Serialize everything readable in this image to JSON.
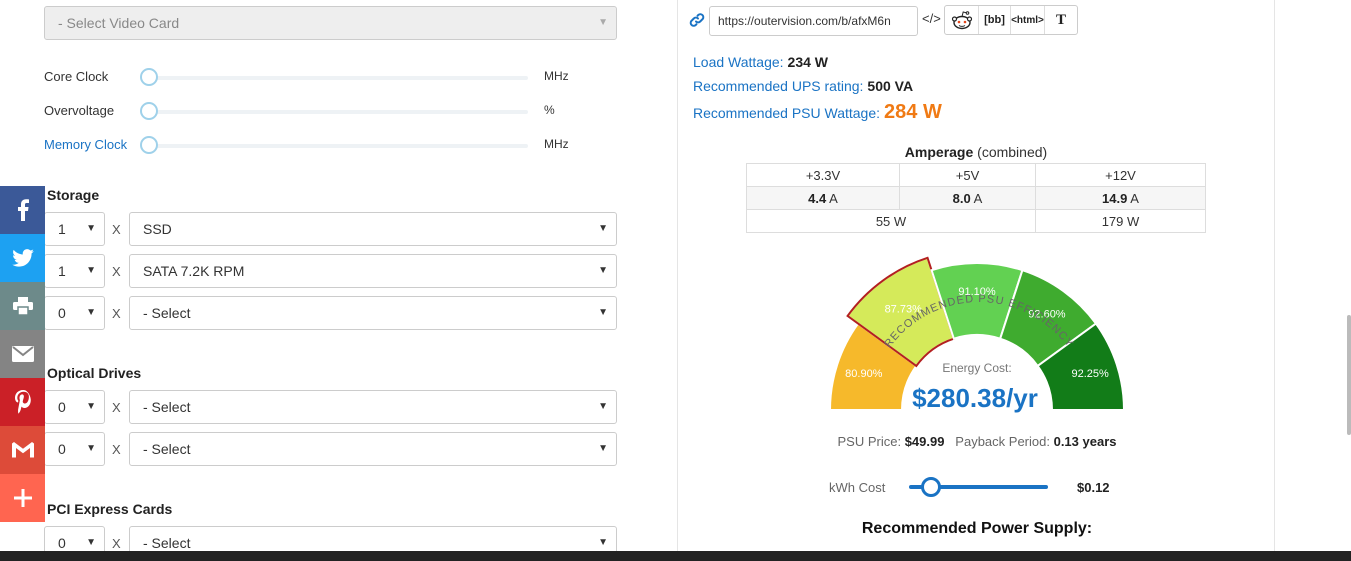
{
  "video_card": {
    "placeholder": "- Select Video Card"
  },
  "sliders": [
    {
      "label": "Core Clock",
      "unit": "MHz"
    },
    {
      "label": "Overvoltage",
      "unit": "%"
    },
    {
      "label": "Memory Clock",
      "unit": "MHz"
    }
  ],
  "x_label": "X",
  "caret": "▼",
  "storage": {
    "title": "Storage",
    "rows": [
      {
        "qty": "1",
        "type": "SSD"
      },
      {
        "qty": "1",
        "type": "SATA 7.2K RPM"
      },
      {
        "qty": "0",
        "type": "- Select"
      }
    ]
  },
  "optical": {
    "title": "Optical Drives",
    "rows": [
      {
        "qty": "0",
        "type": "- Select"
      },
      {
        "qty": "0",
        "type": "- Select"
      }
    ]
  },
  "pci": {
    "title": "PCI Express Cards",
    "rows": [
      {
        "qty": "0",
        "type": "- Select"
      }
    ]
  },
  "social": [
    {
      "icon": "facebook-icon",
      "color": "#3b5998"
    },
    {
      "icon": "twitter-icon",
      "color": "#1da1f2"
    },
    {
      "icon": "print-icon",
      "color": "#6d8a8a"
    },
    {
      "icon": "email-icon",
      "color": "#848484"
    },
    {
      "icon": "pinterest-icon",
      "color": "#cb2027"
    },
    {
      "icon": "gmail-icon",
      "color": "#dd4b39"
    },
    {
      "icon": "more-icon",
      "color": "#ff6550"
    }
  ],
  "share": {
    "url": "https://outervision.com/b/afxM6n",
    "embed": "</>",
    "bb": "[bb]",
    "html": "<html>",
    "text": "T"
  },
  "results": {
    "load_label": "Load Wattage:",
    "load_value": "234 W",
    "ups_label": "Recommended UPS rating:",
    "ups_value": "500 VA",
    "psu_label": "Recommended PSU Wattage:",
    "psu_value": "284 W"
  },
  "amperage": {
    "title": "Amperage",
    "subtitle": "(combined)",
    "rails": [
      "+3.3V",
      "+5V",
      "+12V"
    ],
    "amps": [
      "4.4",
      "8.0",
      "14.9"
    ],
    "amp_unit": "A",
    "watts_combined": "55 W",
    "watts_12v": "179 W"
  },
  "gauge": {
    "arc_title": "RECOMMENDED PSU EFFICIENCY",
    "energy_label": "Energy Cost:",
    "energy_value": "$280.38/yr",
    "segments": [
      {
        "label": "80.90%",
        "color": "#f6b92b"
      },
      {
        "label": "87.73%",
        "color": "#d5ea5a"
      },
      {
        "label": "91.10%",
        "color": "#62d152"
      },
      {
        "label": "92.60%",
        "color": "#3fab2f"
      },
      {
        "label": "92.25%",
        "color": "#127c18"
      }
    ],
    "highlight_color": "#b32020"
  },
  "psu": {
    "price_label": "PSU Price:",
    "price_value": "$49.99",
    "payback_label": "Payback Period:",
    "payback_value": "0.13 years"
  },
  "kwh": {
    "label": "kWh Cost",
    "value": "$0.12"
  },
  "recommended_title": "Recommended Power Supply:"
}
